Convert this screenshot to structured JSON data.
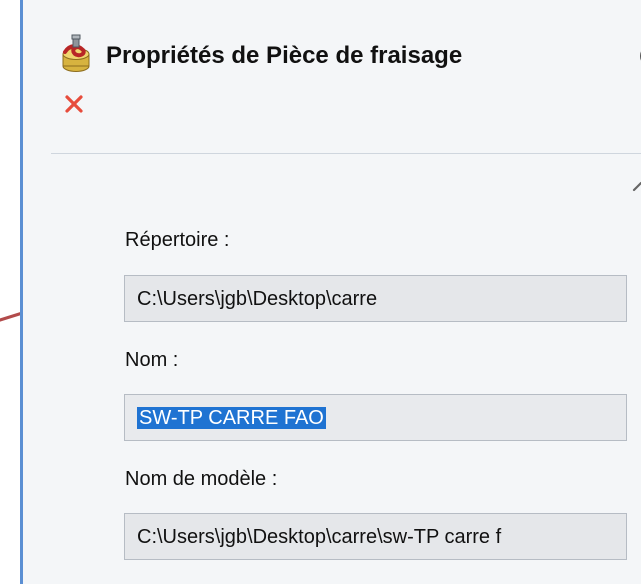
{
  "window": {
    "title": "Propriétés de Pièce de fraisage"
  },
  "icons": {
    "app": "milling-part-icon",
    "help": "help-icon",
    "close": "close-icon",
    "collapse": "chevron-up-icon",
    "arrow": "arrow-icon"
  },
  "fields": {
    "repertoire": {
      "label": "Répertoire :",
      "value": "C:\\Users\\jgb\\Desktop\\carre"
    },
    "nom": {
      "label": "Nom :",
      "value": "SW-TP CARRE FAO"
    },
    "nom_modele": {
      "label": "Nom de modèle :",
      "value": "C:\\Users\\jgb\\Desktop\\carre\\sw-TP carre f"
    }
  },
  "colors": {
    "panel_accent": "#5b8fd3",
    "close_red": "#e74c3c",
    "selection": "#1f73d2",
    "arrow": "#b24b4b"
  }
}
